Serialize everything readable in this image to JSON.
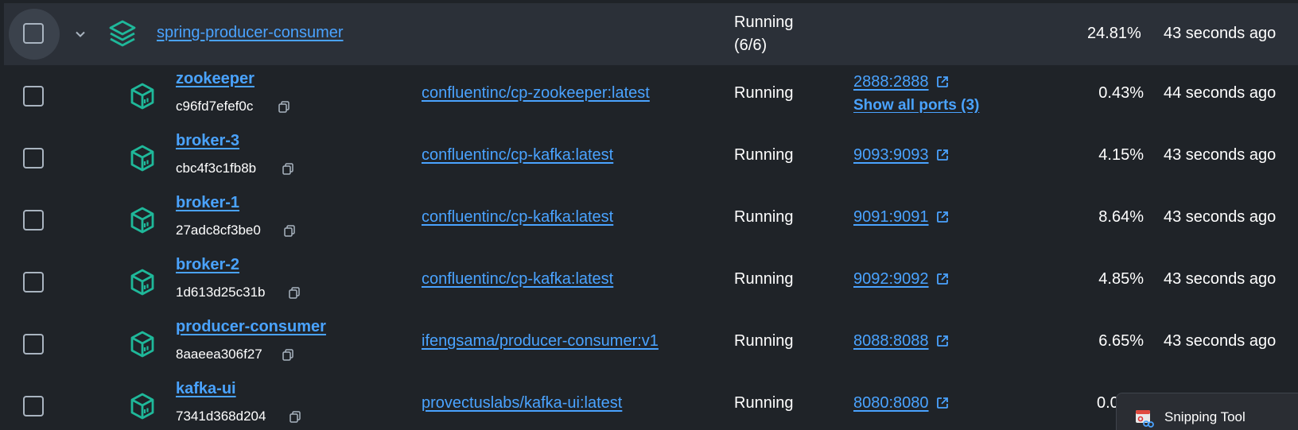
{
  "group": {
    "name": "spring-producer-consumer",
    "status_line1": "Running",
    "status_line2": "(6/6)",
    "cpu": "24.81%",
    "last_started": "43 seconds ago"
  },
  "containers": [
    {
      "name": "zookeeper",
      "id": "c96fd7efef0c",
      "image": "confluentinc/cp-zookeeper:latest",
      "status": "Running",
      "port": "2888:2888",
      "show_ports": "Show all ports (3)",
      "cpu": "0.43%",
      "last_started": "44 seconds ago"
    },
    {
      "name": "broker-3",
      "id": "cbc4f3c1fb8b",
      "image": "confluentinc/cp-kafka:latest",
      "status": "Running",
      "port": "9093:9093",
      "cpu": "4.15%",
      "last_started": "43 seconds ago"
    },
    {
      "name": "broker-1",
      "id": "27adc8cf3be0",
      "image": "confluentinc/cp-kafka:latest",
      "status": "Running",
      "port": "9091:9091",
      "cpu": "8.64%",
      "last_started": "43 seconds ago"
    },
    {
      "name": "broker-2",
      "id": "1d613d25c31b",
      "image": "confluentinc/cp-kafka:latest",
      "status": "Running",
      "port": "9092:9092",
      "cpu": "4.85%",
      "last_started": "43 seconds ago"
    },
    {
      "name": "producer-consumer",
      "id": "8aaeea306f27",
      "image": "ifengsama/producer-consumer:v1",
      "status": "Running",
      "port": "8088:8088",
      "cpu": "6.65%",
      "last_started": "43 seconds ago"
    },
    {
      "name": "kafka-ui",
      "id": "7341d368d204",
      "image": "provectuslabs/kafka-ui:latest",
      "status": "Running",
      "port": "8080:8080",
      "cpu": "0.0",
      "last_started": ""
    }
  ],
  "snipping_tool": {
    "label": "Snipping Tool"
  },
  "colors": {
    "link": "#4aa3ff",
    "icon_teal": "#1fb89a",
    "background": "#1f2328",
    "group_row": "#2b3038"
  },
  "icons": {
    "group": "stack-layers-icon",
    "container": "cube-icon",
    "copy": "copy-icon",
    "external": "external-link-icon",
    "expand": "chevron-down-icon"
  }
}
